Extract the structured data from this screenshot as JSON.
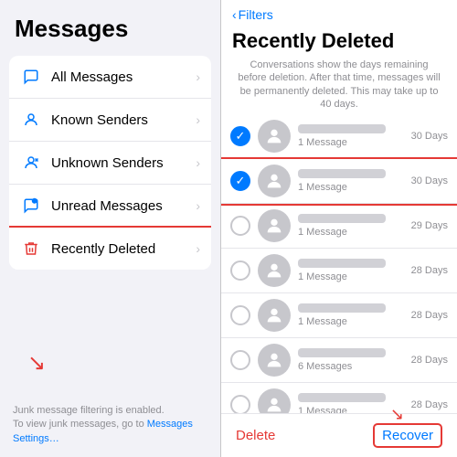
{
  "left": {
    "title": "Messages",
    "menu": [
      {
        "icon": "💬",
        "label": "All Messages",
        "active": false,
        "iconColor": "blue"
      },
      {
        "icon": "👤",
        "label": "Known Senders",
        "active": false,
        "iconColor": "blue"
      },
      {
        "icon": "👤",
        "label": "Unknown Senders",
        "active": false,
        "iconColor": "blue"
      },
      {
        "icon": "💬",
        "label": "Unread Messages",
        "active": false,
        "iconColor": "blue"
      },
      {
        "icon": "🗑️",
        "label": "Recently Deleted",
        "active": true,
        "iconColor": "red"
      }
    ],
    "footer": {
      "line1": "Junk message filtering is enabled.",
      "line2": "To view junk messages, go to ",
      "link": "Messages Settings…"
    }
  },
  "right": {
    "filters_label": "Filters",
    "title": "Recently Deleted",
    "subtitle": "Conversations show the days remaining before deletion. After that time, messages will be permanently deleted. This may take up to 40 days.",
    "messages": [
      {
        "selected": true,
        "days": "30 Days",
        "count": "1 Message"
      },
      {
        "selected": true,
        "days": "30 Days",
        "count": "1 Message"
      },
      {
        "selected": false,
        "days": "29 Days",
        "count": "1 Message"
      },
      {
        "selected": false,
        "days": "28 Days",
        "count": "1 Message"
      },
      {
        "selected": false,
        "days": "28 Days",
        "count": "1 Message"
      },
      {
        "selected": false,
        "days": "28 Days",
        "count": "6 Messages"
      },
      {
        "selected": false,
        "days": "28 Days",
        "count": "1 Message"
      }
    ],
    "footer": {
      "delete_label": "Delete",
      "recover_label": "Recover"
    }
  }
}
